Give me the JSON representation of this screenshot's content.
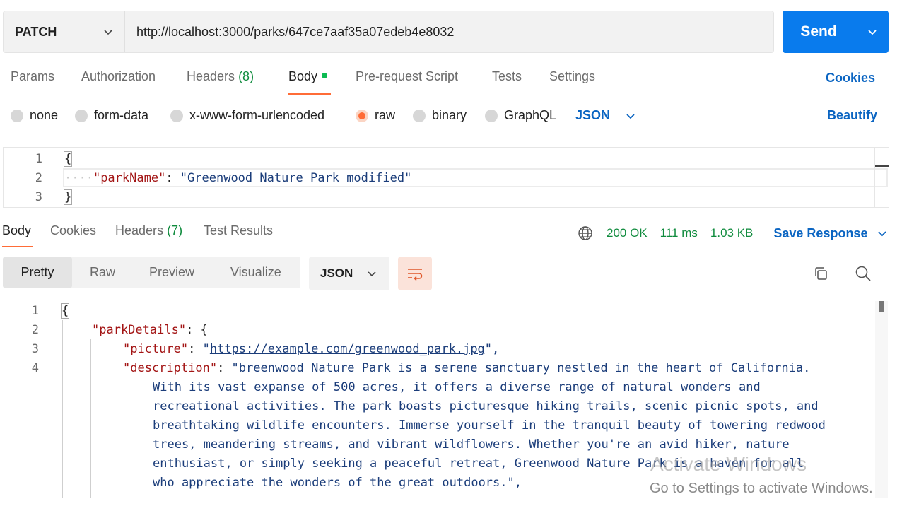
{
  "request": {
    "method": "PATCH",
    "url": "http://localhost:3000/parks/647ce7aaf35a07edeb4e8032",
    "send_label": "Send"
  },
  "request_tabs": {
    "params": "Params",
    "authorization": "Authorization",
    "headers": "Headers",
    "headers_count": "(8)",
    "body": "Body",
    "pre_request": "Pre-request Script",
    "tests": "Tests",
    "settings": "Settings",
    "cookies": "Cookies"
  },
  "body_types": {
    "none": "none",
    "form_data": "form-data",
    "urlencoded": "x-www-form-urlencoded",
    "raw": "raw",
    "binary": "binary",
    "graphql": "GraphQL",
    "selected": "raw",
    "language": "JSON",
    "beautify": "Beautify"
  },
  "request_body": {
    "line_numbers": [
      "1",
      "2",
      "3"
    ],
    "open_brace": "{",
    "key": "\"parkName\"",
    "colon": ": ",
    "value": "\"Greenwood Nature Park modified\"",
    "close_brace": "}"
  },
  "response_tabs": {
    "body": "Body",
    "cookies": "Cookies",
    "headers": "Headers",
    "headers_count": "(7)",
    "test_results": "Test Results"
  },
  "response_status": {
    "status": "200 OK",
    "time": "111 ms",
    "size": "1.03 KB",
    "save_response": "Save Response"
  },
  "view_modes": {
    "pretty": "Pretty",
    "raw": "Raw",
    "preview": "Preview",
    "visualize": "Visualize",
    "format": "JSON"
  },
  "response_body": {
    "line_numbers": [
      "1",
      "2",
      "3",
      "4"
    ],
    "line1": "{",
    "line2_key": "\"parkDetails\"",
    "line2_rest": ": {",
    "line3_key": "\"picture\"",
    "line3_colon": ": ",
    "line3_quote_open": "\"",
    "line3_url": "https://example.com/greenwood_park.jpg",
    "line3_quote_close": "\",",
    "line4_key": "\"description\"",
    "line4_colon": ": ",
    "description_lines": [
      "\"breenwood Nature Park is a serene sanctuary nestled in the heart of California.",
      "With its vast expanse of 500 acres, it offers a diverse range of natural wonders and",
      "recreational activities. The park boasts picturesque hiking trails, scenic picnic spots, and",
      "breathtaking wildlife encounters. Immerse yourself in the tranquil beauty of towering redwood",
      "trees, meandering streams, and vibrant wildflowers. Whether you're an avid hiker, nature",
      "enthusiast, or simply seeking a peaceful retreat, Greenwood Nature Park is a haven for all",
      "who appreciate the wonders of the great outdoors.\","
    ]
  },
  "watermark": {
    "title": "Activate Windows",
    "subtitle": "Go to Settings to activate Windows."
  },
  "colors": {
    "accent": "#ff6c37",
    "send": "#097bed",
    "link": "#0b65c2",
    "status_green": "#0f8b3d"
  }
}
